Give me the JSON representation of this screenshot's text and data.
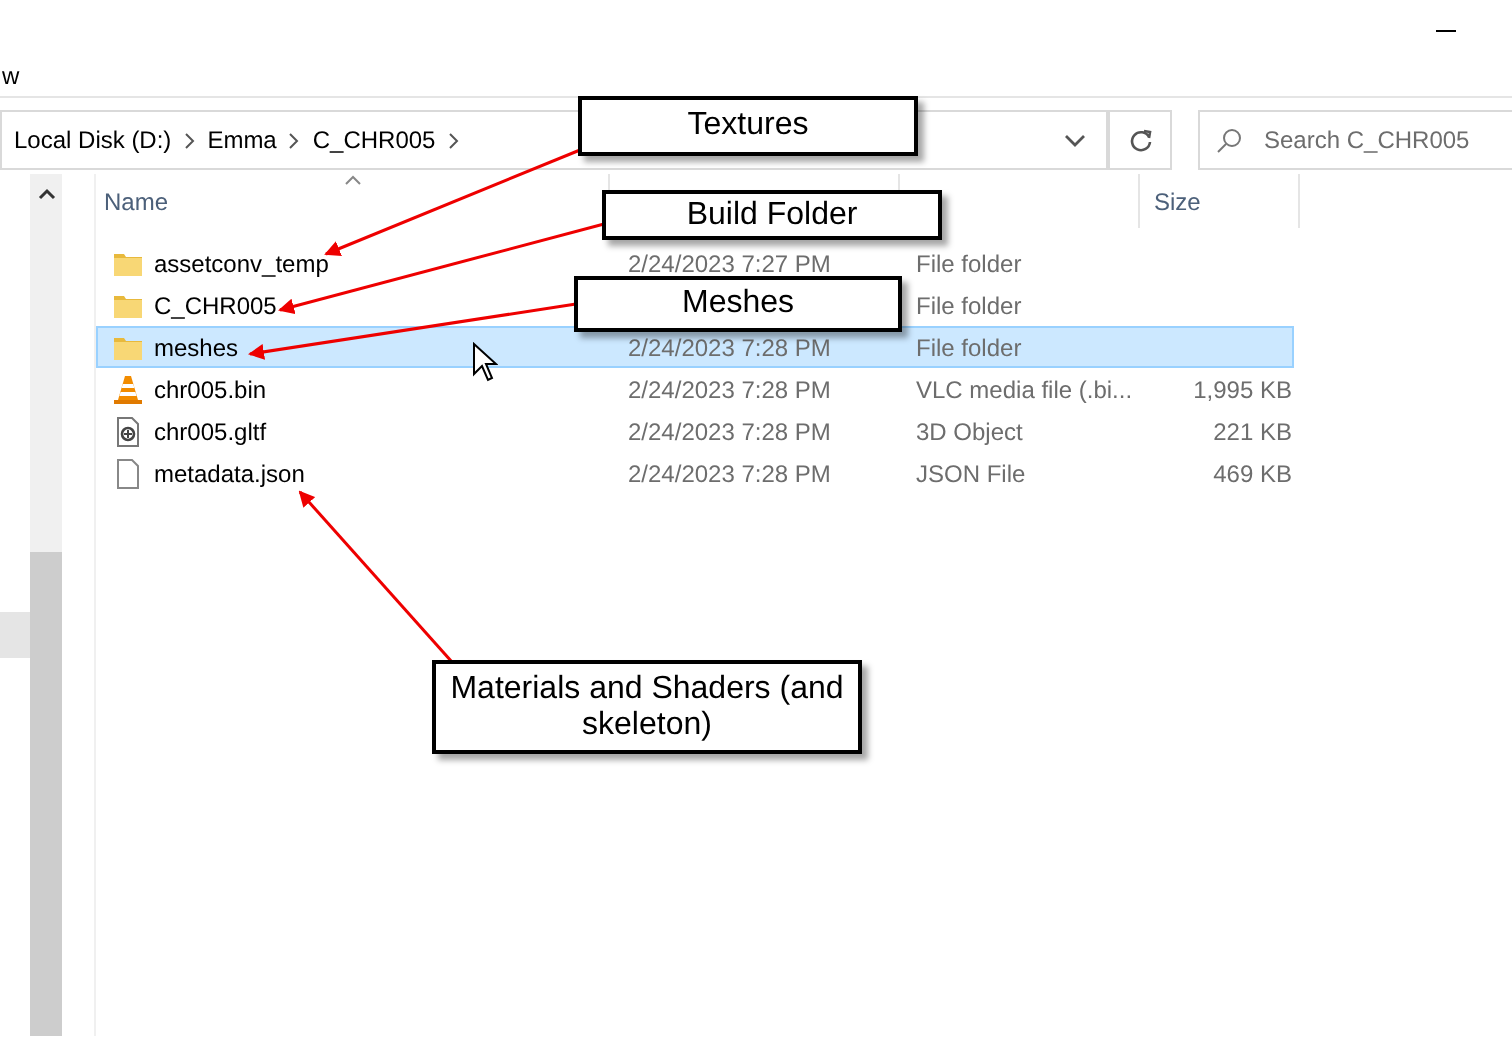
{
  "menu": {
    "partial_item": "w"
  },
  "address_bar": {
    "crumbs": [
      "Local Disk (D:)",
      "Emma",
      "C_CHR005"
    ]
  },
  "search": {
    "placeholder": "Search C_CHR005"
  },
  "columns": {
    "name": "Name",
    "size": "Size"
  },
  "files": [
    {
      "name": "assetconv_temp",
      "kind": "folder",
      "date": "2/24/2023 7:27 PM",
      "type": "File folder",
      "selected": false
    },
    {
      "name": "C_CHR005",
      "kind": "folder",
      "type": "File folder",
      "selected": false
    },
    {
      "name": "meshes",
      "kind": "folder",
      "date": "2/24/2023 7:28 PM",
      "type": "File folder",
      "selected": true
    },
    {
      "name": "chr005.bin",
      "kind": "media",
      "date": "2/24/2023 7:28 PM",
      "type": "VLC media file (.bi...",
      "size": "1,995 KB",
      "selected": false
    },
    {
      "name": "chr005.gltf",
      "kind": "object",
      "date": "2/24/2023 7:28 PM",
      "type": "3D Object",
      "size": "221 KB",
      "selected": false
    },
    {
      "name": "metadata.json",
      "kind": "file",
      "date": "2/24/2023 7:28 PM",
      "type": "JSON File",
      "size": "469 KB",
      "selected": false
    }
  ],
  "callouts": [
    {
      "text": "Textures"
    },
    {
      "text": "Build Folder"
    },
    {
      "text": "Meshes"
    },
    {
      "text": "Materials and Shaders (and skeleton)"
    }
  ]
}
